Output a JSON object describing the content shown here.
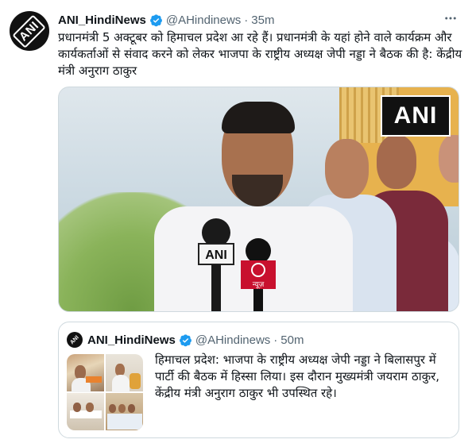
{
  "tweet": {
    "author_name": "ANI_HindiNews",
    "handle": "@AHindinews",
    "separator": "·",
    "time": "35m",
    "avatar_text": "ANI",
    "more_icon": "more-icon",
    "text": "प्रधानमंत्री 5 अक्टूबर को हिमाचल प्रदेश आ रहे हैं। प्रधानमंत्री के यहां होने वाले कार्यक्रम और कार्यकर्ताओं से संवाद करने को लेकर भाजपा के राष्ट्रीय अध्यक्ष जेपी नड्डा ने बैठक की है: केंद्रीय मंत्री अनुराग ठाकुर",
    "media": {
      "watermark": "ANI",
      "mic_left_label": "ANI",
      "mic_right_label": "न्यूज़"
    }
  },
  "quoted_tweet": {
    "author_name": "ANI_HindiNews",
    "handle": "@AHindinews",
    "separator": "·",
    "time": "50m",
    "avatar_text": "ANI",
    "text": "हिमाचल प्रदेश: भाजपा के राष्ट्रीय अध्यक्ष जेपी नड्डा ने बिलासपुर में पार्टी की बैठक में हिस्सा लिया। इस दौरान मुख्यमंत्री जयराम ठाकुर, केंद्रीय मंत्री अनुराग ठाकुर भी उपस्थित रहे।"
  },
  "colors": {
    "verified": "#1d9bf0",
    "secondary_text": "#536471",
    "border": "#cfd9de"
  }
}
